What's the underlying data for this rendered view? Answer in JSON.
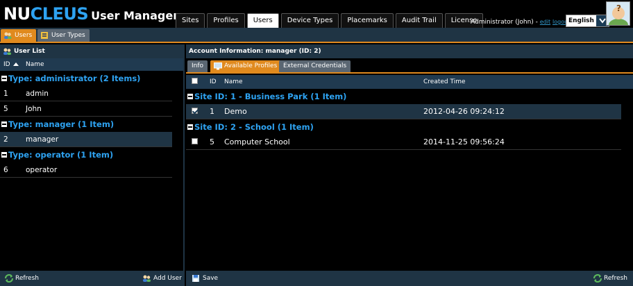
{
  "header": {
    "brand_part1": "NU",
    "brand_part2": "CLEUS",
    "app_title": "User Manager",
    "tabs": [
      {
        "label": "Sites",
        "active": false
      },
      {
        "label": "Profiles",
        "active": false
      },
      {
        "label": "Users",
        "active": true
      },
      {
        "label": "Device Types",
        "active": false
      },
      {
        "label": "Placemarks",
        "active": false
      },
      {
        "label": "Audit Trail",
        "active": false
      },
      {
        "label": "License",
        "active": false
      }
    ],
    "user_text": "Administrator (John) - ",
    "edit_link": "edit",
    "logout_link": "logout",
    "language": "English"
  },
  "subtabs": {
    "users": "Users",
    "user_types": "User Types"
  },
  "left": {
    "title": "User List",
    "col_id": "ID",
    "col_name": "Name",
    "groups": [
      {
        "label": "Type: administrator (2 Items)",
        "rows": [
          {
            "id": "1",
            "name": "admin"
          },
          {
            "id": "5",
            "name": "John"
          }
        ]
      },
      {
        "label": "Type: manager (1 Item)",
        "rows": [
          {
            "id": "2",
            "name": "manager"
          }
        ]
      },
      {
        "label": "Type: operator (1 Item)",
        "rows": [
          {
            "id": "6",
            "name": "operator"
          }
        ]
      }
    ],
    "refresh": "Refresh",
    "add_user": "Add User"
  },
  "right": {
    "title": "Account Information: manager (ID: 2)",
    "tabs": {
      "info": "Info",
      "available": "Available Profiles",
      "external": "External Credentials"
    },
    "col_id": "ID",
    "col_name": "Name",
    "col_time": "Created Time",
    "groups": [
      {
        "label": "Site ID: 1 - Business Park (1 Item)",
        "rows": [
          {
            "id": "1",
            "name": "Demo",
            "time": "2012-04-26 09:24:12",
            "checked": true
          }
        ]
      },
      {
        "label": "Site ID: 2 - School (1 Item)",
        "rows": [
          {
            "id": "5",
            "name": "Computer School",
            "time": "2014-11-25 09:56:24",
            "checked": false
          }
        ]
      }
    ],
    "save": "Save",
    "refresh": "Refresh"
  },
  "colors": {
    "accent": "#e08a1e",
    "header_blue": "#2ea3f2",
    "panel_bar": "#1f3444"
  }
}
